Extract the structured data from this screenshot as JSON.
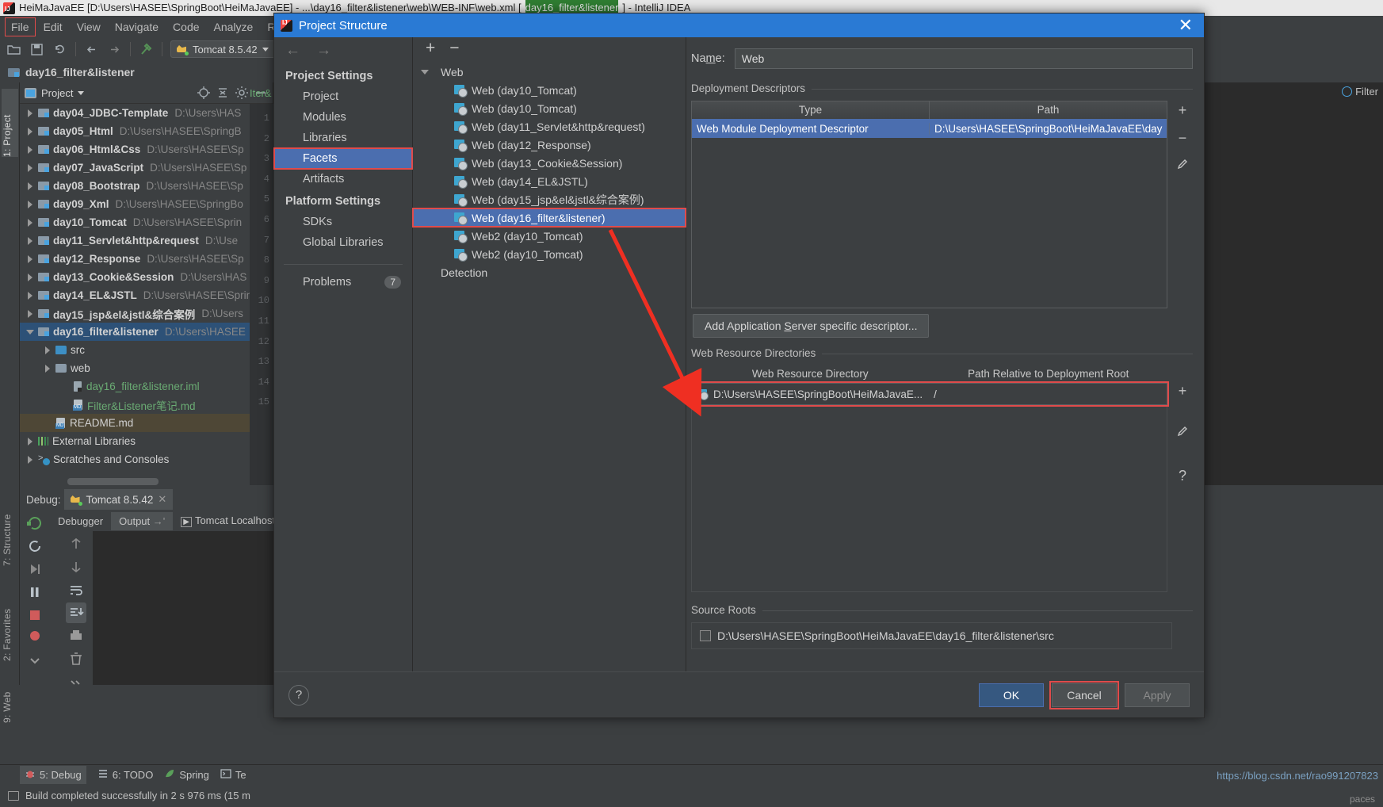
{
  "window": {
    "title_prefix": "HeiMaJavaEE [D:\\Users\\HASEE\\SpringBoot\\HeiMaJavaEE] - ...\\day16_filter&listener\\web\\WEB-INF\\web.xml [",
    "title_selected": "day16_filter&listener",
    "title_suffix": "] - IntelliJ IDEA"
  },
  "menu": [
    {
      "label": "File"
    },
    {
      "label": "Edit"
    },
    {
      "label": "View"
    },
    {
      "label": "Navigate"
    },
    {
      "label": "Code"
    },
    {
      "label": "Analyze"
    },
    {
      "label": "Refa"
    }
  ],
  "toolbar": {
    "run_config": "Tomcat 8.5.42"
  },
  "breadcrumb": {
    "module": "day16_filter&listener"
  },
  "editor": {
    "line_numbers": [
      "1",
      "2",
      "3",
      "4",
      "5",
      "6",
      "7",
      "8",
      "9",
      "10",
      "11",
      "12",
      "13",
      "14",
      "15"
    ],
    "iter_label": "Iter&"
  },
  "right_tabs": {
    "filter": "Filter"
  },
  "left_vtabs": [
    {
      "label": "1: Project",
      "selected": true
    },
    {
      "label": "7: Structure",
      "selected": false
    },
    {
      "label": "2: Favorites",
      "selected": false
    },
    {
      "label": "9: Web",
      "selected": false
    }
  ],
  "project_window": {
    "title": "Project",
    "tree": [
      {
        "name": "day04_JDBC-Template",
        "path": "D:\\Users\\HAS",
        "indent": 0,
        "arrow": "closed",
        "icon": "module-icon",
        "style": "bold"
      },
      {
        "name": "day05_Html",
        "path": "D:\\Users\\HASEE\\SpringB",
        "indent": 0,
        "arrow": "closed",
        "icon": "module-icon",
        "style": "bold"
      },
      {
        "name": "day06_Html&Css",
        "path": "D:\\Users\\HASEE\\Sp",
        "indent": 0,
        "arrow": "closed",
        "icon": "module-icon",
        "style": "bold"
      },
      {
        "name": "day07_JavaScript",
        "path": "D:\\Users\\HASEE\\Sp",
        "indent": 0,
        "arrow": "closed",
        "icon": "module-icon",
        "style": "bold"
      },
      {
        "name": "day08_Bootstrap",
        "path": "D:\\Users\\HASEE\\Sp",
        "indent": 0,
        "arrow": "closed",
        "icon": "module-icon",
        "style": "bold"
      },
      {
        "name": "day09_Xml",
        "path": "D:\\Users\\HASEE\\SpringBo",
        "indent": 0,
        "arrow": "closed",
        "icon": "module-icon",
        "style": "bold"
      },
      {
        "name": "day10_Tomcat",
        "path": "D:\\Users\\HASEE\\Sprin",
        "indent": 0,
        "arrow": "closed",
        "icon": "module-icon",
        "style": "bold"
      },
      {
        "name": "day11_Servlet&http&request",
        "path": "D:\\Use",
        "indent": 0,
        "arrow": "closed",
        "icon": "module-icon",
        "style": "bold"
      },
      {
        "name": "day12_Response",
        "path": "D:\\Users\\HASEE\\Sp",
        "indent": 0,
        "arrow": "closed",
        "icon": "module-icon",
        "style": "bold"
      },
      {
        "name": "day13_Cookie&Session",
        "path": "D:\\Users\\HAS",
        "indent": 0,
        "arrow": "closed",
        "icon": "module-icon",
        "style": "bold"
      },
      {
        "name": "day14_EL&JSTL",
        "path": "D:\\Users\\HASEE\\Sprin",
        "indent": 0,
        "arrow": "closed",
        "icon": "module-icon",
        "style": "bold"
      },
      {
        "name": "day15_jsp&el&jstl&综合案例",
        "path": "D:\\Users",
        "indent": 0,
        "arrow": "closed",
        "icon": "module-icon",
        "style": "bold"
      },
      {
        "name": "day16_filter&listener",
        "path": "D:\\Users\\HASEE",
        "indent": 0,
        "arrow": "open",
        "icon": "module-icon",
        "style": "bold",
        "selected": true
      },
      {
        "name": "src",
        "path": "",
        "indent": 1,
        "arrow": "closed",
        "icon": "source-folder-icon",
        "style": "plain"
      },
      {
        "name": "web",
        "path": "",
        "indent": 1,
        "arrow": "closed",
        "icon": "folder-icon",
        "style": "plain"
      },
      {
        "name": "day16_filter&listener.iml",
        "path": "",
        "indent": 2,
        "arrow": "none",
        "icon": "iml-file-icon",
        "style": "green"
      },
      {
        "name": "Filter&Listener笔记.md",
        "path": "",
        "indent": 2,
        "arrow": "none",
        "icon": "markdown-file-icon",
        "style": "green"
      },
      {
        "name": "README.md",
        "path": "",
        "indent": 1,
        "arrow": "none",
        "icon": "markdown-file-icon",
        "style": "plain",
        "highlight": true
      },
      {
        "name": "External Libraries",
        "path": "",
        "indent": 0,
        "arrow": "closed",
        "icon": "library-icon",
        "style": "plain"
      },
      {
        "name": "Scratches and Consoles",
        "path": "",
        "indent": 0,
        "arrow": "closed",
        "icon": "scratches-icon",
        "style": "plain"
      }
    ]
  },
  "debug_window": {
    "label": "Debug:",
    "config_tab": "Tomcat 8.5.42",
    "tabs": [
      {
        "label": "Debugger",
        "selected": false
      },
      {
        "label": "Output",
        "selected": true
      },
      {
        "label": "Tomcat Localhost",
        "selected": false
      }
    ]
  },
  "bottom_bar": [
    {
      "label": "5: Debug",
      "icon": "bug-icon",
      "selected": true
    },
    {
      "label": "6: TODO",
      "icon": "list-icon",
      "selected": false
    },
    {
      "label": "Spring",
      "icon": "leaf-icon",
      "selected": false
    },
    {
      "label": "Te",
      "icon": "terminal-icon",
      "selected": false
    }
  ],
  "status_bar": {
    "message": "Build completed successfully in 2 s 976 ms (15 m",
    "right_hint": "paces"
  },
  "watermark": "https://blog.csdn.net/rao991207823",
  "dialog": {
    "title": "Project Structure",
    "close_icon": "close-icon",
    "nav": {
      "back": "back-arrow-icon",
      "forward": "forward-arrow-icon"
    },
    "sections": [
      {
        "header": "Project Settings",
        "items": [
          {
            "label": "Project",
            "selected": false
          },
          {
            "label": "Modules",
            "selected": false
          },
          {
            "label": "Libraries",
            "selected": false
          },
          {
            "label": "Facets",
            "selected": true,
            "boxed": true
          },
          {
            "label": "Artifacts",
            "selected": false
          }
        ]
      },
      {
        "header": "Platform Settings",
        "items": [
          {
            "label": "SDKs",
            "selected": false
          },
          {
            "label": "Global Libraries",
            "selected": false
          }
        ]
      }
    ],
    "problems": {
      "label": "Problems",
      "count": "7"
    },
    "facet_toolbar": {
      "add": "+",
      "remove": "−"
    },
    "facet_tree": [
      {
        "label": "Web",
        "type": "group",
        "arrow": "open"
      },
      {
        "label": "Web (day10_Tomcat)",
        "type": "facet"
      },
      {
        "label": "Web (day10_Tomcat)",
        "type": "facet"
      },
      {
        "label": "Web (day11_Servlet&http&request)",
        "type": "facet"
      },
      {
        "label": "Web (day12_Response)",
        "type": "facet"
      },
      {
        "label": "Web (day13_Cookie&Session)",
        "type": "facet"
      },
      {
        "label": "Web (day14_EL&JSTL)",
        "type": "facet"
      },
      {
        "label": "Web (day15_jsp&el&jstl&综合案例)",
        "type": "facet"
      },
      {
        "label": "Web (day16_filter&listener)",
        "type": "facet",
        "selected": true,
        "boxed": true
      },
      {
        "label": "Web2 (day10_Tomcat)",
        "type": "facet"
      },
      {
        "label": "Web2 (day10_Tomcat)",
        "type": "facet"
      },
      {
        "label": "Detection",
        "type": "group",
        "arrow": "none"
      }
    ],
    "name_field": {
      "label": "Name:",
      "value": "Web"
    },
    "deployment_descriptors": {
      "group_label": "Deployment Descriptors",
      "columns": [
        "Type",
        "Path"
      ],
      "rows": [
        {
          "type": "Web Module Deployment Descriptor",
          "path": "D:\\Users\\HASEE\\SpringBoot\\HeiMaJavaEE\\day",
          "selected": true
        }
      ],
      "side_buttons": [
        "+",
        "−",
        "edit-pencil-icon"
      ],
      "add_button": "Add Application Server specific descriptor..."
    },
    "web_resource_directories": {
      "group_label": "Web Resource Directories",
      "columns": [
        "Web Resource Directory",
        "Path Relative to Deployment Root"
      ],
      "rows": [
        {
          "directory": "D:\\Users\\HASEE\\SpringBoot\\HeiMaJavaE...",
          "relative": "/"
        }
      ],
      "side_buttons": [
        "+",
        "edit-pencil-icon",
        "?"
      ]
    },
    "source_roots": {
      "group_label": "Source Roots",
      "rows": [
        {
          "path": "D:\\Users\\HASEE\\SpringBoot\\HeiMaJavaEE\\day16_filter&listener\\src",
          "checked": false
        }
      ]
    },
    "footer": {
      "help": "?",
      "ok": "OK",
      "cancel": "Cancel",
      "apply": "Apply"
    }
  }
}
